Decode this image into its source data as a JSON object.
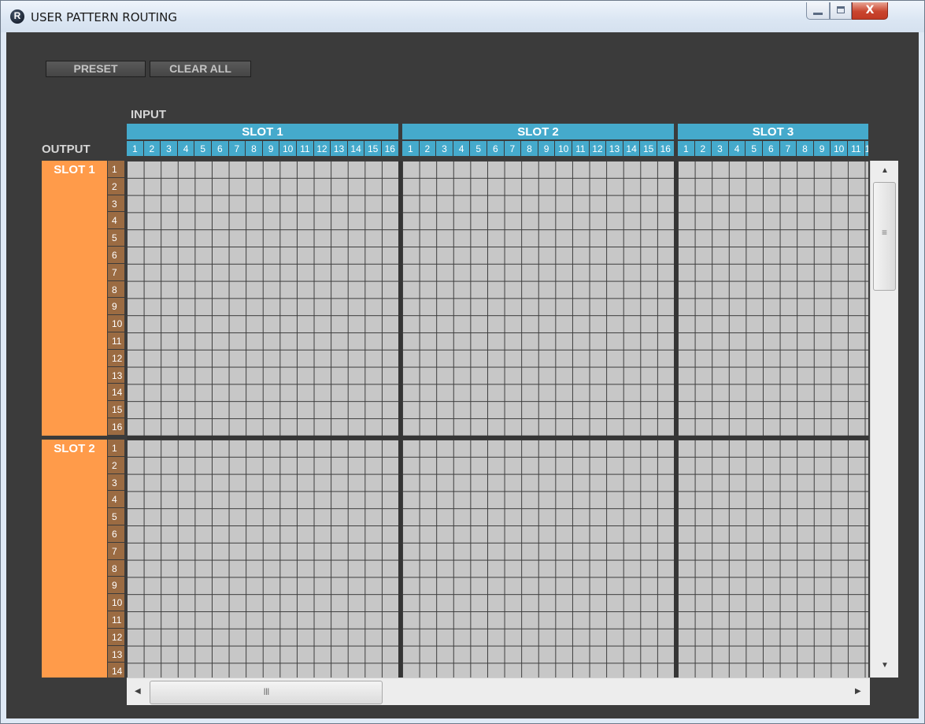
{
  "window": {
    "title": "USER PATTERN ROUTING",
    "icon": "R",
    "controls": {
      "minimize": "minimize-icon",
      "maximize": "maximize-icon",
      "close": "X"
    }
  },
  "toolbar": {
    "preset_label": "PRESET",
    "clear_all_label": "CLEAR ALL"
  },
  "matrix": {
    "input_label": "INPUT",
    "output_label": "OUTPUT",
    "input_slots": [
      "SLOT 1",
      "SLOT 2",
      "SLOT 3"
    ],
    "output_slots": [
      "SLOT 1",
      "SLOT 2"
    ],
    "channel_numbers": [
      "1",
      "2",
      "3",
      "4",
      "5",
      "6",
      "7",
      "8",
      "9",
      "10",
      "11",
      "12",
      "13",
      "14",
      "15",
      "16"
    ],
    "colors": {
      "input_header": "#45aacc",
      "output_header": "#ff9b4a",
      "output_number": "#9b6b42",
      "cell": "#c7c7c7",
      "background": "#3b3b3b"
    }
  },
  "scrollbars": {
    "vertical_grip": "≡",
    "horizontal_grip": "III"
  }
}
